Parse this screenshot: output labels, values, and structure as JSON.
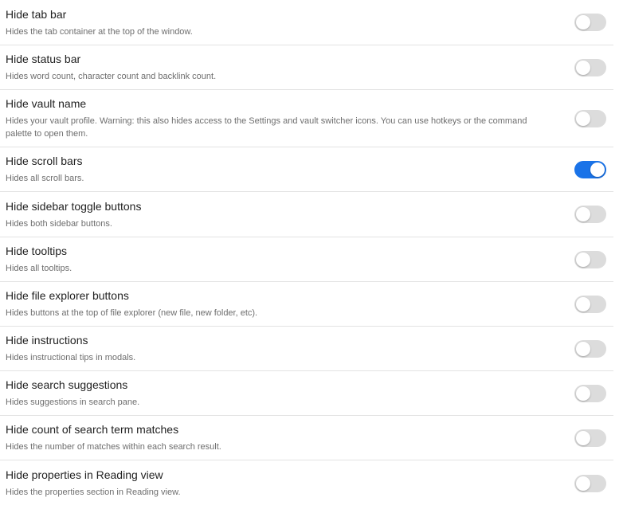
{
  "accent_color": "#1a73e8",
  "settings": [
    {
      "name": "Hide tab bar",
      "desc": "Hides the tab container at the top of the window.",
      "enabled": false
    },
    {
      "name": "Hide status bar",
      "desc": "Hides word count, character count and backlink count.",
      "enabled": false
    },
    {
      "name": "Hide vault name",
      "desc": "Hides your vault profile. Warning: this also hides access to the Settings and vault switcher icons. You can use hotkeys or the command palette to open them.",
      "enabled": false
    },
    {
      "name": "Hide scroll bars",
      "desc": "Hides all scroll bars.",
      "enabled": true
    },
    {
      "name": "Hide sidebar toggle buttons",
      "desc": "Hides both sidebar buttons.",
      "enabled": false
    },
    {
      "name": "Hide tooltips",
      "desc": "Hides all tooltips.",
      "enabled": false
    },
    {
      "name": "Hide file explorer buttons",
      "desc": "Hides buttons at the top of file explorer (new file, new folder, etc).",
      "enabled": false
    },
    {
      "name": "Hide instructions",
      "desc": "Hides instructional tips in modals.",
      "enabled": false
    },
    {
      "name": "Hide search suggestions",
      "desc": "Hides suggestions in search pane.",
      "enabled": false
    },
    {
      "name": "Hide count of search term matches",
      "desc": "Hides the number of matches within each search result.",
      "enabled": false
    },
    {
      "name": "Hide properties in Reading view",
      "desc": "Hides the properties section in Reading view.",
      "enabled": false
    }
  ]
}
